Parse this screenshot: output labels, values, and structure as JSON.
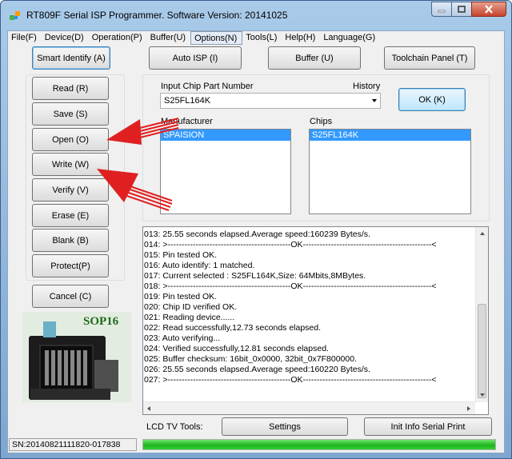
{
  "window": {
    "title": "RT809F Serial ISP Programmer. Software Version: 20141025"
  },
  "menu": [
    {
      "label": "File(F)"
    },
    {
      "label": "Device(D)"
    },
    {
      "label": "Operation(P)"
    },
    {
      "label": "Buffer(U)"
    },
    {
      "label": "Options(N)"
    },
    {
      "label": "Tools(L)"
    },
    {
      "label": "Help(H)"
    },
    {
      "label": "Language(G)"
    }
  ],
  "toolbar": {
    "smart_identify": "Smart Identify (A)",
    "auto_isp": "Auto ISP (I)",
    "buffer": "Buffer (U)",
    "toolchain_panel": "Toolchain Panel (T)"
  },
  "operations": {
    "read": "Read (R)",
    "save": "Save (S)",
    "open": "Open (O)",
    "write": "Write  (W)",
    "verify": "Verify (V)",
    "erase": "Erase (E)",
    "blank": "Blank (B)",
    "protect": "Protect(P)",
    "cancel": "Cancel (C)"
  },
  "chip_select": {
    "part_number_label": "Input Chip Part Number",
    "history_label": "History",
    "part_number_value": "S25FL164K",
    "ok_button": "OK (K)",
    "manufacturer_label": "Manufacturer",
    "manufacturer_selected": "SPAISION",
    "chips_label": "Chips",
    "chip_selected": "S25FL164K"
  },
  "package_image": {
    "label": "SOP16"
  },
  "log": [
    "013:  25.55 seconds elapsed.Average speed:160239 Bytes/s.",
    "014:  >--------------------------------------------OK----------------------------------------------<",
    "015:  Pin tested OK.",
    "016:  Auto identify: 1 matched.",
    "017:  Current selected : S25FL164K,Size: 64Mbits,8MBytes.",
    "018:  >--------------------------------------------OK----------------------------------------------<",
    "019:  Pin tested OK.",
    "020:  Chip ID verified OK.",
    "021:  Reading device......",
    "022:  Read successfully,12.73 seconds elapsed.",
    "023:  Auto verifying...",
    "024:  Verified successfully,12.81 seconds elapsed.",
    "025:  Buffer checksum: 16bit_0x0000, 32bit_0x7F800000.",
    "026:  25.55 seconds elapsed.Average speed:160220 Bytes/s.",
    "027:  >--------------------------------------------OK----------------------------------------------<"
  ],
  "bottom_tools": {
    "lcd_label": "LCD TV Tools:",
    "settings": "Settings",
    "init_info": "Init Info Serial Print"
  },
  "status": {
    "serial_number": "SN:20140821111820-017838",
    "progress": 1.0
  },
  "colors": {
    "selection": "#3399ff",
    "progress": "#2fcf2f",
    "annotation_arrow": "#e02020"
  }
}
